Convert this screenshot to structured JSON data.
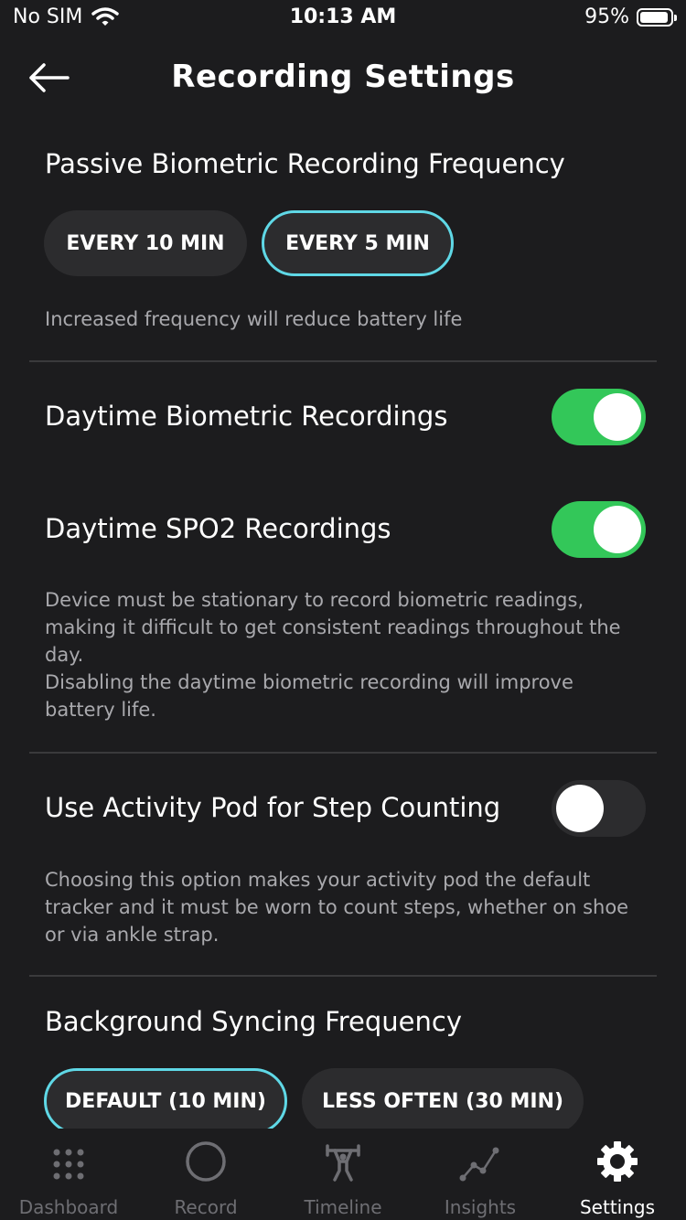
{
  "status_bar": {
    "carrier": "No SIM",
    "time": "10:13 AM",
    "battery": "95%"
  },
  "header": {
    "title": "Recording Settings"
  },
  "passive": {
    "title": "Passive Biometric Recording Frequency",
    "options": [
      {
        "label": "EVERY 10 MIN",
        "selected": false
      },
      {
        "label": "EVERY 5 MIN",
        "selected": true
      }
    ],
    "note": "Increased frequency will reduce battery life"
  },
  "daytime_biometric": {
    "label": "Daytime Biometric Recordings",
    "enabled": true
  },
  "daytime_spo2": {
    "label": "Daytime SPO2 Recordings",
    "enabled": true
  },
  "daytime_note": {
    "line1": "Device must be stationary to record biometric readings, making it difficult to get consistent readings throughout the day.",
    "line2": "Disabling the daytime biometric recording will improve battery life."
  },
  "activity_pod": {
    "label": "Use Activity Pod for Step Counting",
    "enabled": false,
    "note": "Choosing this option makes your activity pod the default tracker and it must be worn to count steps, whether on shoe or via ankle strap."
  },
  "syncing": {
    "title": "Background Syncing Frequency",
    "options": [
      {
        "label": "DEFAULT (10 MIN)",
        "selected": true
      },
      {
        "label": "LESS OFTEN (30 MIN)",
        "selected": false
      }
    ]
  },
  "tabs": [
    {
      "label": "Dashboard",
      "icon": "dots-grid-icon",
      "active": false
    },
    {
      "label": "Record",
      "icon": "circle-icon",
      "active": false
    },
    {
      "label": "Timeline",
      "icon": "weightlifter-icon",
      "active": false
    },
    {
      "label": "Insights",
      "icon": "line-graph-icon",
      "active": false
    },
    {
      "label": "Settings",
      "icon": "gear-icon",
      "active": true
    }
  ],
  "colors": {
    "accent": "#5fd8e6",
    "toggle_on": "#33c759",
    "background": "#1c1c1e",
    "pill": "#2c2c2e"
  }
}
